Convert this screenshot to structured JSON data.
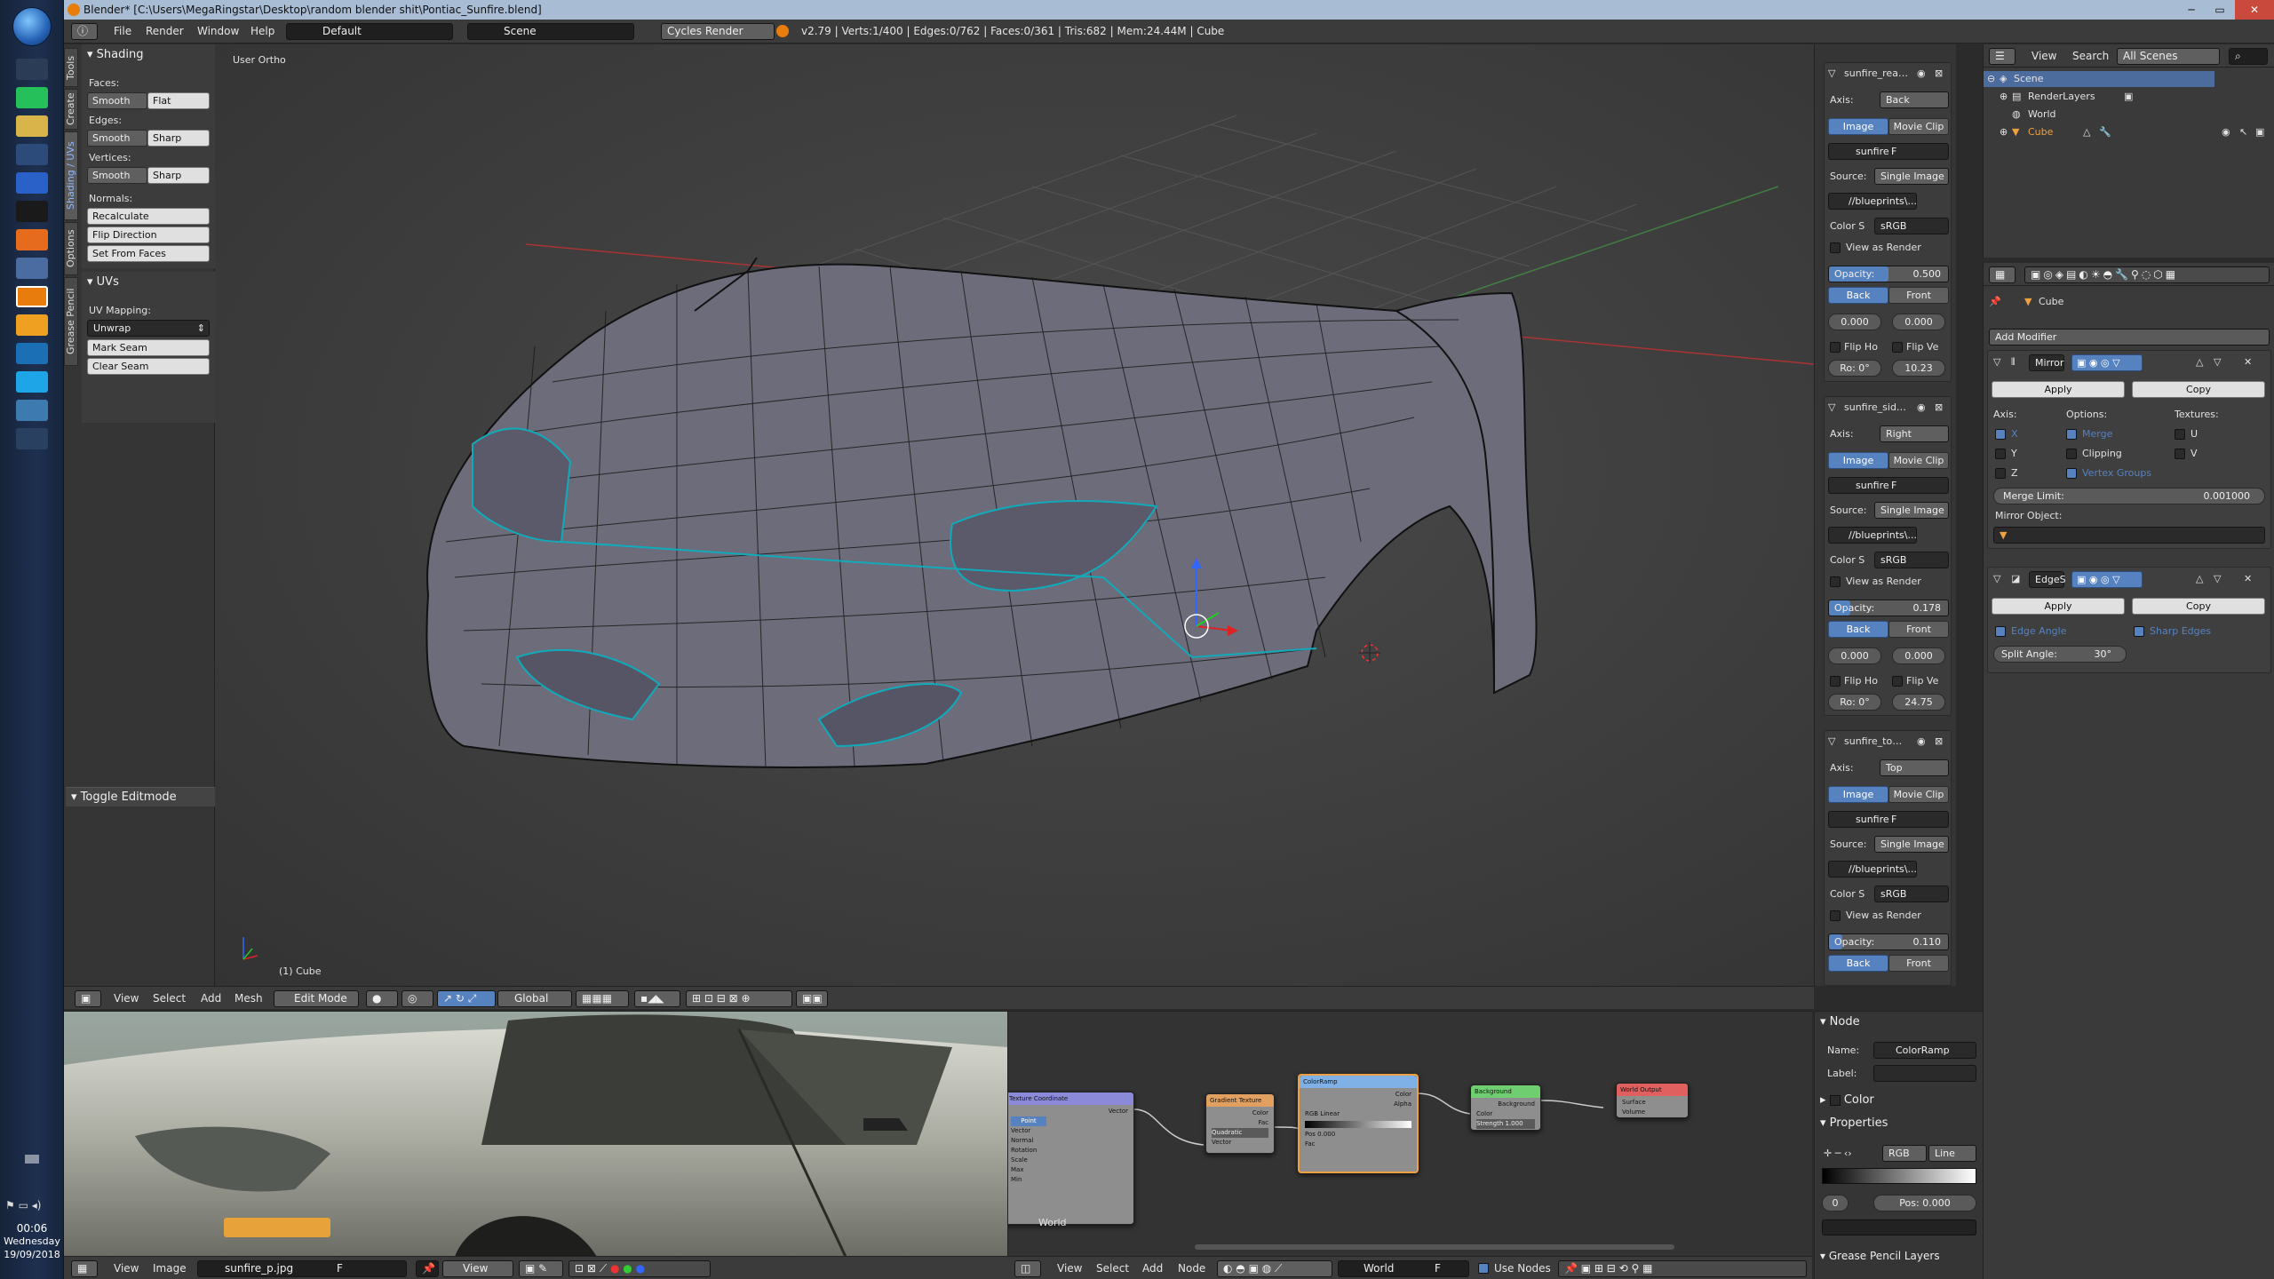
{
  "window": {
    "title": "Blender* [C:\\Users\\MegaRingstar\\Desktop\\random blender shit\\Pontiac_Sunfire.blend]"
  },
  "menu": {
    "file": "File",
    "render": "Render",
    "window": "Window",
    "help": "Help",
    "layout": "Default",
    "scene": "Scene",
    "engine": "Cycles Render",
    "stats": "v2.79 | Verts:1/400 | Edges:0/762 | Faces:0/361 | Tris:682 | Mem:24.44M | Cube"
  },
  "tool_tabs": [
    "Tools",
    "Create",
    "Shading / UVs",
    "Options",
    "Grease Pencil"
  ],
  "tool_panel": {
    "shading_header": "Shading",
    "faces_label": "Faces:",
    "edges_label": "Edges:",
    "vertices_label": "Vertices:",
    "smooth": "Smooth",
    "flat": "Flat",
    "sharp": "Sharp",
    "normals_label": "Normals:",
    "recalculate": "Recalculate",
    "flip_direction": "Flip Direction",
    "set_from_faces": "Set From Faces",
    "uvs_header": "UVs",
    "uv_mapping_label": "UV Mapping:",
    "unwrap": "Unwrap",
    "mark_seam": "Mark Seam",
    "clear_seam": "Clear Seam",
    "toggle_editmode": "Toggle Editmode"
  },
  "viewport": {
    "view_name": "User Ortho",
    "object_label": "(1) Cube"
  },
  "viewport_header": {
    "view": "View",
    "select": "Select",
    "add": "Add",
    "mesh": "Mesh",
    "mode": "Edit Mode",
    "orientation": "Global"
  },
  "background_images": [
    {
      "name": "sunfire_rear....",
      "axis_label": "Axis:",
      "axis": "Back",
      "image": "Image",
      "movie_clip": "Movie Clip",
      "datablock": "sunfire",
      "f": "F",
      "source_label": "Source:",
      "source": "Single Image",
      "path": "//blueprints\\...",
      "colorspace_label": "Color S",
      "colorspace": "sRGB",
      "view_as_render": "View as Render",
      "opacity": "Opacity:",
      "opacity_value": "0.500",
      "opacity_fraction": 0.5,
      "back": "Back",
      "front": "Front",
      "x": "0.000",
      "y": "0.000",
      "flip_h": "Flip Ho",
      "flip_v": "Flip Ve",
      "rot": "Ro: 0°",
      "size": "10.23"
    },
    {
      "name": "sunfire_side.j...",
      "axis_label": "Axis:",
      "axis": "Right",
      "image": "Image",
      "movie_clip": "Movie Clip",
      "datablock": "sunfire",
      "f": "F",
      "source_label": "Source:",
      "source": "Single Image",
      "path": "//blueprints\\...",
      "colorspace_label": "Color S",
      "colorspace": "sRGB",
      "view_as_render": "View as Render",
      "opacity": "Opacity:",
      "opacity_value": "0.178",
      "opacity_fraction": 0.178,
      "back": "Back",
      "front": "Front",
      "x": "0.000",
      "y": "0.000",
      "flip_h": "Flip Ho",
      "flip_v": "Flip Ve",
      "rot": "Ro: 0°",
      "size": "24.75"
    },
    {
      "name": "sunfire_top.j...",
      "axis_label": "Axis:",
      "axis": "Top",
      "image": "Image",
      "movie_clip": "Movie Clip",
      "datablock": "sunfire",
      "f": "F",
      "source_label": "Source:",
      "source": "Single Image",
      "path": "//blueprints\\...",
      "colorspace_label": "Color S",
      "colorspace": "sRGB",
      "view_as_render": "View as Render",
      "opacity": "Opacity:",
      "opacity_value": "0.110",
      "opacity_fraction": 0.11,
      "back": "Back",
      "front": "Front"
    }
  ],
  "outliner": {
    "view": "View",
    "search": "Search",
    "filter": "All Scenes",
    "items": [
      "Scene",
      "RenderLayers",
      "World",
      "Cube"
    ]
  },
  "properties": {
    "object": "Cube",
    "add_modifier": "Add Modifier",
    "mirror": {
      "name": "Mirror",
      "apply": "Apply",
      "copy": "Copy",
      "axis_label": "Axis:",
      "options_label": "Options:",
      "textures_label": "Textures:",
      "x": "X",
      "y": "Y",
      "z": "Z",
      "merge": "Merge",
      "clipping": "Clipping",
      "vertex_groups": "Vertex Groups",
      "u": "U",
      "v": "V",
      "merge_limit_label": "Merge Limit:",
      "merge_limit": "0.001000",
      "mirror_object_label": "Mirror Object:"
    },
    "edgesplit": {
      "name": "EdgeS",
      "apply": "Apply",
      "copy": "Copy",
      "edge_angle": "Edge Angle",
      "sharp_edges": "Sharp Edges",
      "split_angle_label": "Split Angle:",
      "split_angle": "30°"
    }
  },
  "image_editor": {
    "view": "View",
    "image": "Image",
    "image_name": "sunfire_p.jpg",
    "f": "F",
    "view2": "View"
  },
  "node_editor": {
    "view": "View",
    "select": "Select",
    "add": "Add",
    "node": "Node",
    "world": "World",
    "f": "F",
    "use_nodes": "Use Nodes",
    "world_label": "World",
    "nodes": [
      {
        "title": "Texture Coordinate",
        "color": "#8a8ad8",
        "rows": [
          "Vector",
          "Point",
          "Vector",
          "Normal",
          "Rotation",
          "Scale",
          "Max",
          "Min"
        ]
      },
      {
        "title": "Gradient Texture",
        "color": "#e2a060",
        "rows": [
          "Color",
          "Fac",
          "Quadratic",
          "Vector"
        ]
      },
      {
        "title": "ColorRamp",
        "color": "#7fb0e6",
        "rows": [
          "Color",
          "Alpha",
          "RGB",
          "Linear",
          "Pos",
          "0.000",
          "Fac"
        ]
      },
      {
        "title": "Background",
        "color": "#6fcf70",
        "rows": [
          "Background",
          "Color",
          "Strength 1.000"
        ]
      },
      {
        "title": "World Output",
        "color": "#e06060",
        "rows": [
          "Surface",
          "Volume"
        ]
      }
    ]
  },
  "node_props": {
    "node_header": "Node",
    "name_label": "Name:",
    "name": "ColorRamp",
    "label_label": "Label:",
    "color_header": "Color",
    "properties_header": "Properties",
    "mode": "RGB",
    "interp": "Line",
    "index": "0",
    "pos": "Pos: 0.000",
    "grease_pencil": "Grease Pencil Layers"
  },
  "taskbar": {
    "time": "00:06",
    "day": "Wednesday",
    "date": "19/09/2018"
  }
}
